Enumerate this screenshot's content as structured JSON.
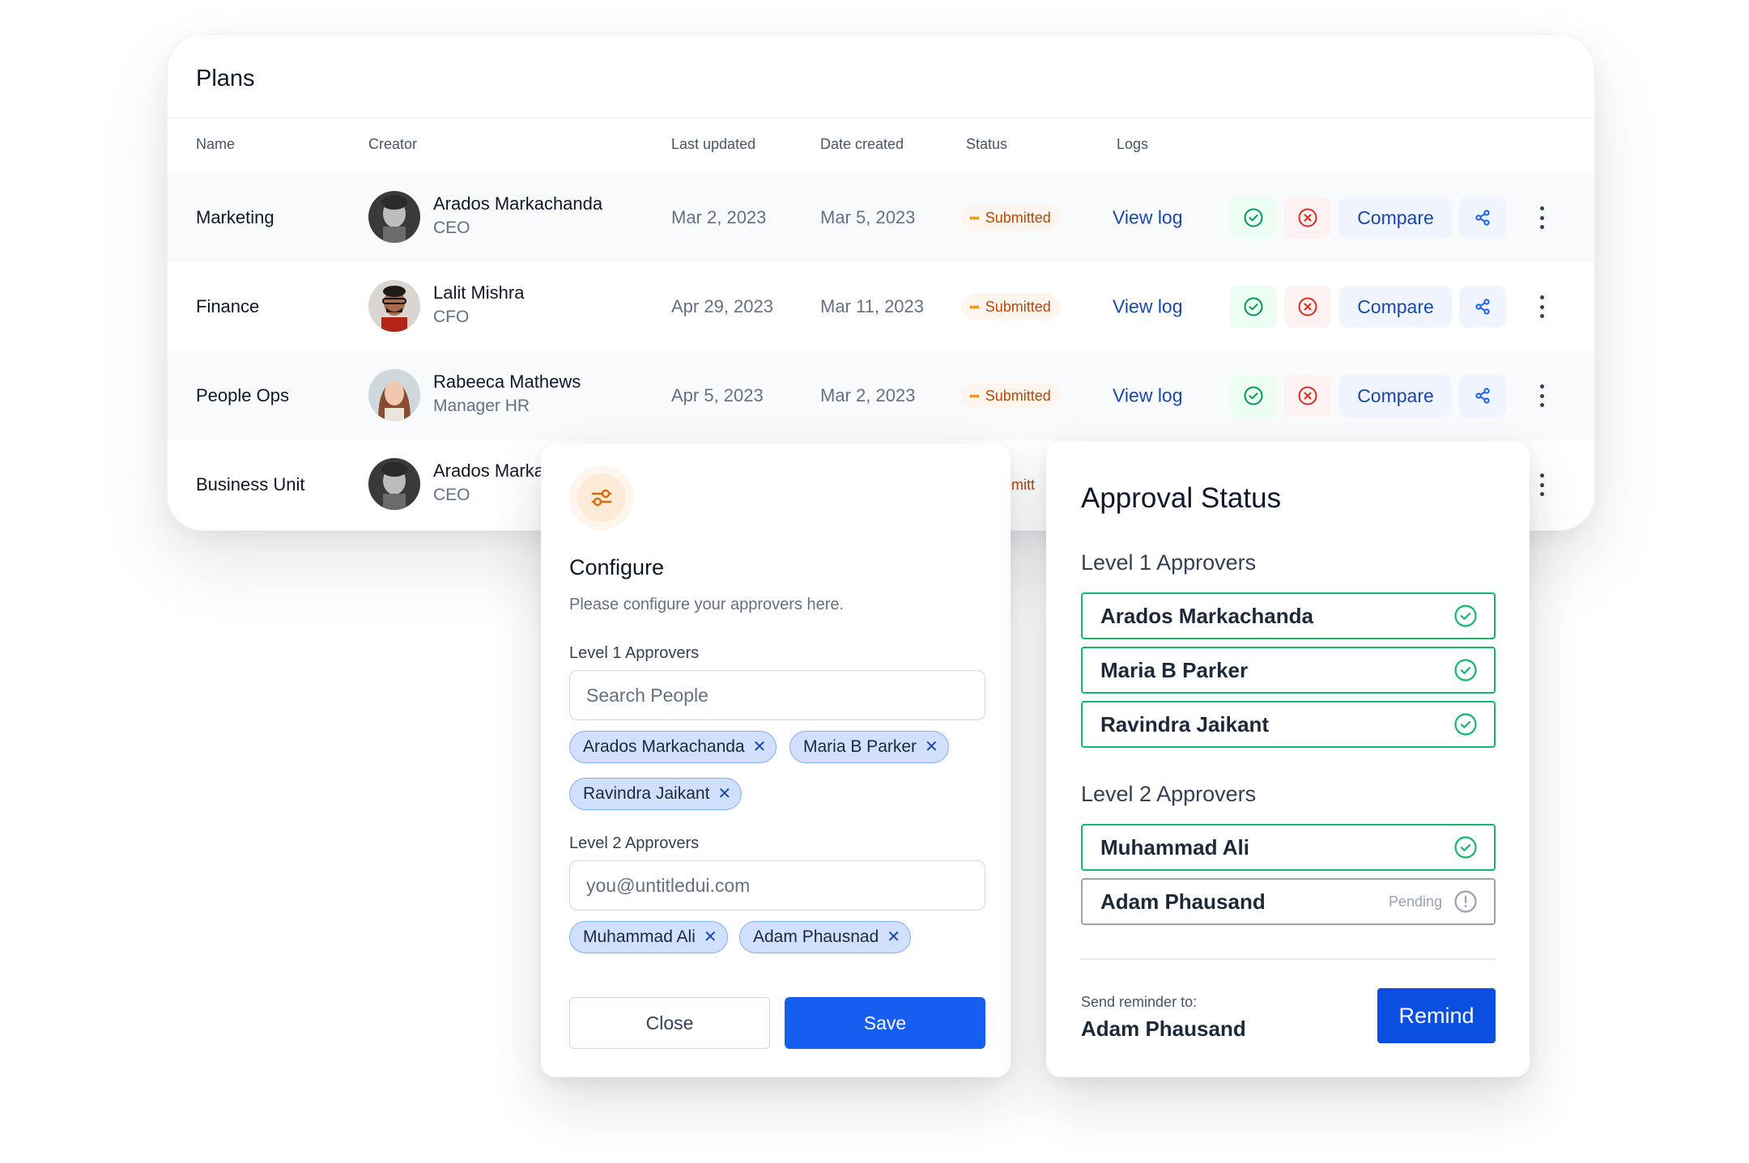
{
  "plans": {
    "title": "Plans",
    "columns": {
      "name": "Name",
      "creator": "Creator",
      "last_updated": "Last updated",
      "date_created": "Date created",
      "status": "Status",
      "logs": "Logs"
    },
    "rows": [
      {
        "name": "Marketing",
        "creator": "Arados Markachanda",
        "role": "CEO",
        "last_updated": "Mar 2, 2023",
        "date_created": "Mar 5, 2023",
        "status": "Submitted",
        "log": "View log",
        "compare": "Compare"
      },
      {
        "name": "Finance",
        "creator": "Lalit Mishra",
        "role": "CFO",
        "last_updated": "Apr 29, 2023",
        "date_created": "Mar 11, 2023",
        "status": "Submitted",
        "log": "View log",
        "compare": "Compare"
      },
      {
        "name": "People Ops",
        "creator": "Rabeeca Mathews",
        "role": "Manager HR",
        "last_updated": "Apr 5, 2023",
        "date_created": "Mar 2, 2023",
        "status": "Submitted",
        "log": "View log",
        "compare": "Compare"
      },
      {
        "name": "Business Unit",
        "creator": "Arados Marka",
        "role": "CEO",
        "status": "Submitt"
      }
    ]
  },
  "configure": {
    "title": "Configure",
    "subtitle": "Please configure your approvers here.",
    "level1_label": "Level 1 Approvers",
    "level1_placeholder": "Search People",
    "level1_chips": [
      "Arados Markachanda",
      "Maria B Parker",
      "Ravindra Jaikant"
    ],
    "level2_label": "Level 2 Approvers",
    "level2_placeholder": "you@untitledui.com",
    "level2_chips": [
      "Muhammad Ali",
      "Adam Phausnad"
    ],
    "close_label": "Close",
    "save_label": "Save"
  },
  "approval": {
    "title": "Approval Status",
    "level1_label": "Level 1 Approvers",
    "level1": [
      {
        "name": "Arados Markachanda",
        "state": "approved"
      },
      {
        "name": "Maria B Parker",
        "state": "approved"
      },
      {
        "name": "Ravindra Jaikant",
        "state": "approved"
      }
    ],
    "level2_label": "Level 2 Approvers",
    "level2": [
      {
        "name": "Muhammad Ali",
        "state": "approved"
      },
      {
        "name": "Adam Phausand",
        "state": "pending",
        "state_label": "Pending"
      }
    ],
    "reminder_label": "Send reminder to:",
    "reminder_name": "Adam Phausand",
    "remind_label": "Remind"
  },
  "icons": {
    "approve": "check-circle-icon",
    "reject": "x-circle-icon",
    "share": "share-icon",
    "more": "more-vertical-icon",
    "configure": "sliders-icon",
    "pending": "alert-circle-icon",
    "remove": "x-icon"
  },
  "colors": {
    "primary": "#155eef",
    "success": "#12b76a",
    "error": "#d92d20",
    "warning": "#f79009",
    "chip_bg": "#d1e0ff"
  }
}
